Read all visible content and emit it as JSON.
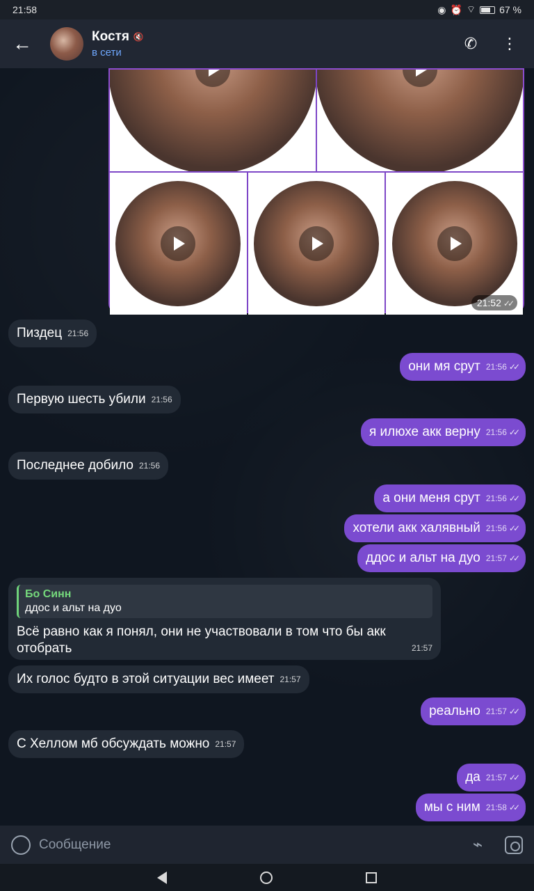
{
  "status": {
    "time": "21:58",
    "battery_text": "67 %",
    "icons": [
      "eye-icon",
      "alarm-icon",
      "wifi-icon",
      "battery-icon"
    ]
  },
  "header": {
    "title": "Костя",
    "subtitle": "в сети",
    "icons": [
      "back-arrow-icon",
      "mute-icon",
      "phone-icon",
      "more-vert-icon"
    ]
  },
  "media": {
    "time": "21:52"
  },
  "messages": [
    {
      "id": "m1",
      "dir": "in",
      "text": "Пиздец",
      "time": "21:56"
    },
    {
      "id": "m2",
      "dir": "out",
      "text": "они мя срут",
      "time": "21:56"
    },
    {
      "id": "m3",
      "dir": "in",
      "text": "Первую шесть убили",
      "time": "21:56"
    },
    {
      "id": "m4",
      "dir": "out",
      "text": "я илюхе акк верну",
      "time": "21:56"
    },
    {
      "id": "m5",
      "dir": "in",
      "text": "Последнее добило",
      "time": "21:56"
    },
    {
      "id": "m6",
      "dir": "out",
      "text": "а они меня срут",
      "time": "21:56"
    },
    {
      "id": "m7",
      "dir": "out",
      "text": "хотели акк халявный",
      "time": "21:56"
    },
    {
      "id": "m8",
      "dir": "out",
      "text": "ддос и альт на дуо",
      "time": "21:57"
    },
    {
      "id": "m9",
      "dir": "in",
      "text": "Их голос будто в этой ситуации вес имеет",
      "time": "21:57"
    },
    {
      "id": "m10",
      "dir": "out",
      "text": "реально",
      "time": "21:57"
    },
    {
      "id": "m11",
      "dir": "in",
      "text": "С Хеллом мб обсуждать можно",
      "time": "21:57"
    },
    {
      "id": "m12",
      "dir": "out",
      "text": "да",
      "time": "21:57"
    },
    {
      "id": "m13",
      "dir": "out",
      "text": "мы с ним",
      "time": "21:58"
    }
  ],
  "reply_message": {
    "quote_name": "Бо Синн",
    "quote_text": "ддос и альт на дуо",
    "text": "Всё равно как я понял, они не участвовали в том что бы акк отобрать",
    "time": "21:57"
  },
  "composer": {
    "placeholder": "Сообщение",
    "icons": [
      "sticker-icon",
      "attach-icon",
      "camera-icon"
    ]
  },
  "navbar": {
    "icons": [
      "nav-back-icon",
      "nav-home-icon",
      "nav-recent-icon"
    ]
  }
}
